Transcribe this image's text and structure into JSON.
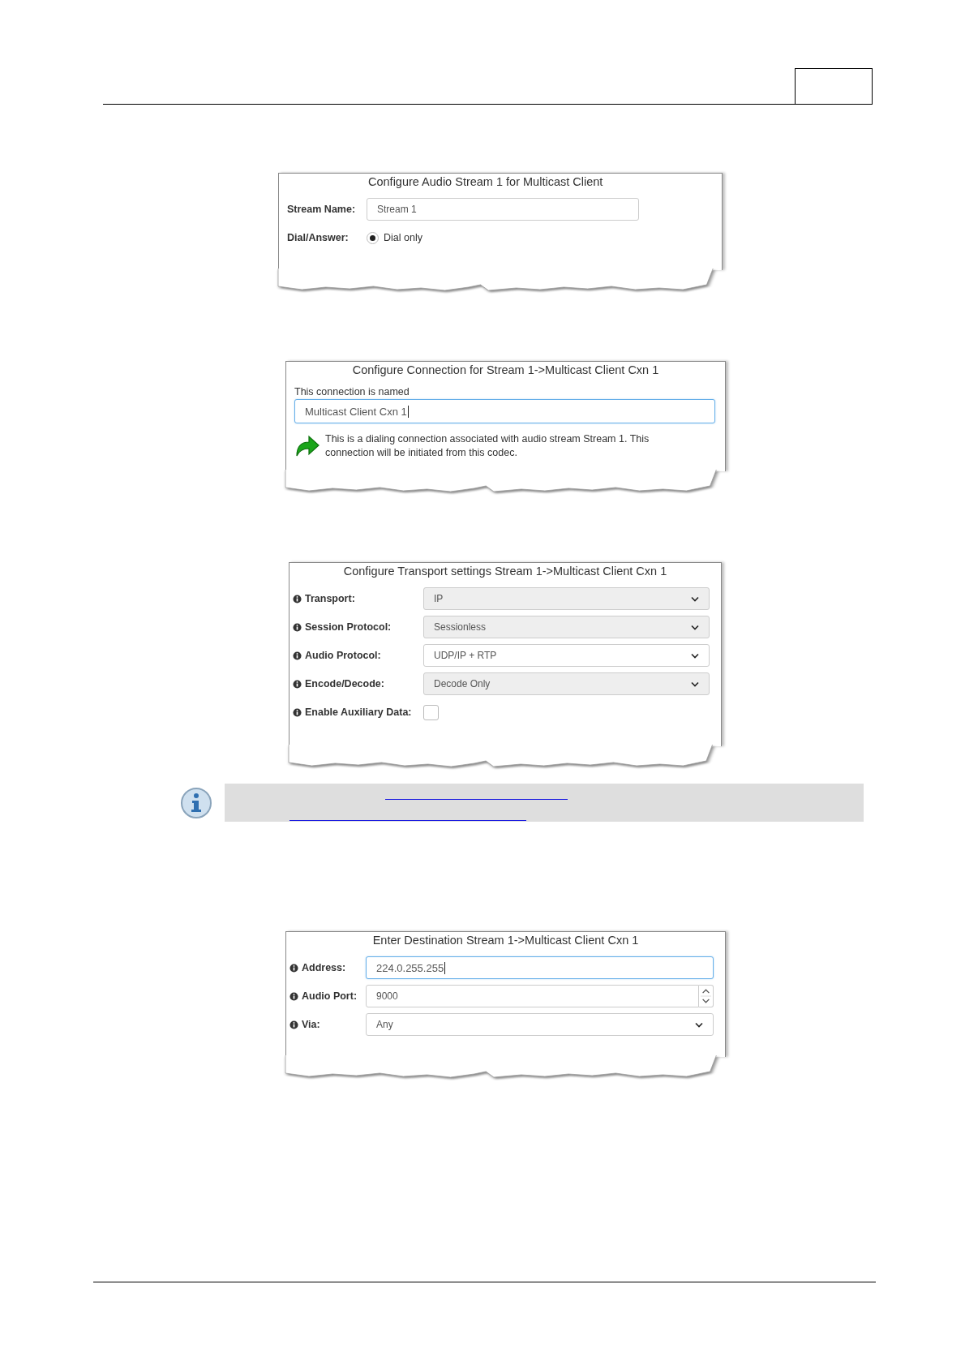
{
  "panels": [
    {
      "title": "Configure Audio Stream 1 for Multicast Client",
      "rows": [
        {
          "kind": "text",
          "label": "Stream Name:",
          "value": "Stream 1"
        },
        {
          "kind": "radio",
          "label": "Dial/Answer:",
          "option": "Dial only",
          "selected": true
        }
      ]
    },
    {
      "title": "Configure Connection for Stream 1->Multicast Client Cxn 1",
      "rows": [
        {
          "kind": "stacked",
          "label": "This connection is named",
          "value": "Multicast Client Cxn 1",
          "focused": true
        },
        {
          "kind": "note",
          "text": "This is a dialing connection associated with audio stream Stream 1. This connection will be initiated from this codec."
        }
      ]
    },
    {
      "title": "Configure Transport settings Stream 1->Multicast Client Cxn 1",
      "rows": [
        {
          "kind": "select",
          "info": true,
          "label": "Transport:",
          "value": "IP",
          "disabled": true
        },
        {
          "kind": "select",
          "info": true,
          "label": "Session Protocol:",
          "value": "Sessionless",
          "disabled": true
        },
        {
          "kind": "select",
          "info": true,
          "label": "Audio Protocol:",
          "value": "UDP/IP + RTP",
          "disabled": false
        },
        {
          "kind": "select",
          "info": true,
          "label": "Encode/Decode:",
          "value": "Decode Only",
          "disabled": true
        },
        {
          "kind": "checkbox",
          "info": true,
          "label": "Enable Auxiliary Data:",
          "checked": false
        }
      ]
    },
    {
      "title": "Enter Destination Stream 1->Multicast Client Cxn 1",
      "rows": [
        {
          "kind": "text",
          "info": true,
          "label": "Address:",
          "value": "224.0.255.255",
          "focused": true
        },
        {
          "kind": "number",
          "info": true,
          "label": "Audio Port:",
          "value": "9000"
        },
        {
          "kind": "select",
          "info": true,
          "label": "Via:",
          "value": "Any",
          "disabled": false
        }
      ]
    }
  ]
}
